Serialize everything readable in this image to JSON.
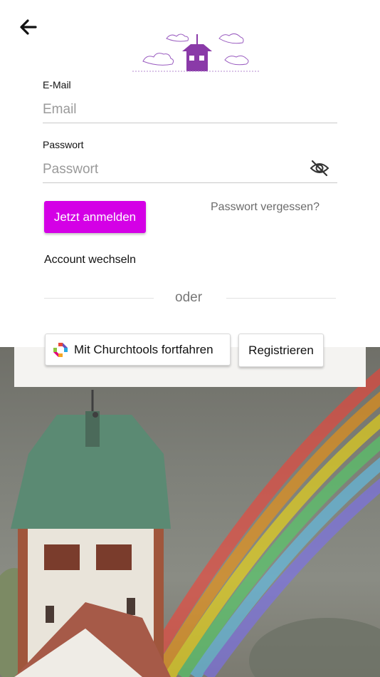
{
  "icons": {
    "back": "arrow-left-icon",
    "visibility": "eye-off-icon",
    "churchtools": "churchtools-logo-icon"
  },
  "colors": {
    "primary": "#d400e6",
    "logo": "#8a3aa8",
    "divider": "#e2e2e2"
  },
  "form": {
    "email_label": "E-Mail",
    "email_placeholder": "Email",
    "email_value": "",
    "password_label": "Passwort",
    "password_placeholder": "Passwort",
    "password_value": ""
  },
  "actions": {
    "login_label": "Jetzt anmelden",
    "forgot_label": "Passwort vergessen?",
    "switch_account_label": "Account wechseln",
    "divider_text": "oder",
    "sso_label": "Mit Churchtools fortfahren",
    "register_label": "Registrieren"
  }
}
